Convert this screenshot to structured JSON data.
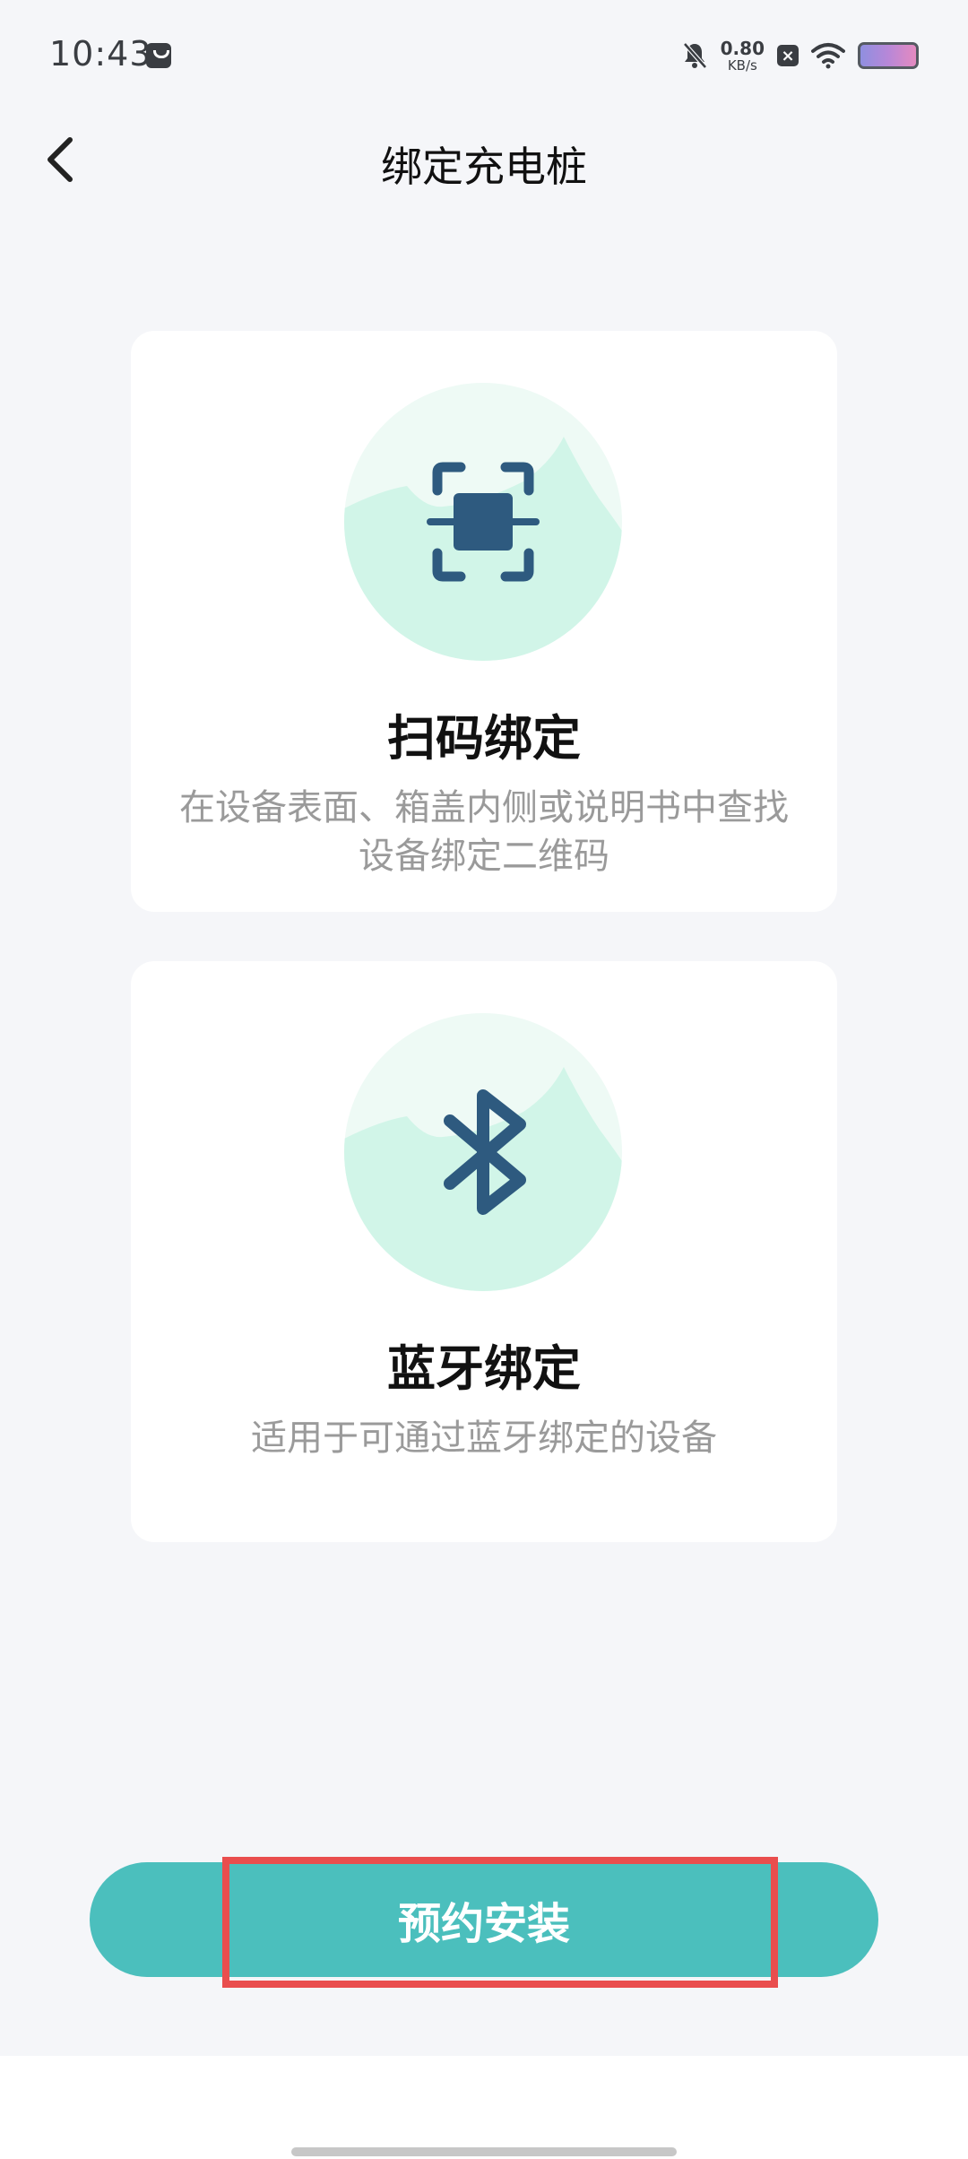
{
  "status_bar": {
    "time": "10:43",
    "net_speed_value": "0.80",
    "net_speed_unit": "KB/s"
  },
  "header": {
    "title": "绑定充电桩"
  },
  "cards": [
    {
      "title": "扫码绑定",
      "description": "在设备表面、箱盖内侧或说明书中查找设备绑定二维码",
      "icon": "qr-scan-icon"
    },
    {
      "title": "蓝牙绑定",
      "description": "适用于可通过蓝牙绑定的设备",
      "icon": "bluetooth-icon"
    }
  ],
  "footer": {
    "book_button_label": "预约安装"
  },
  "colors": {
    "accent": "#4bbfbd",
    "icon_dark": "#2e5a7f",
    "hero_mint": "#d1f5e8",
    "highlight": "#e94e4e"
  }
}
